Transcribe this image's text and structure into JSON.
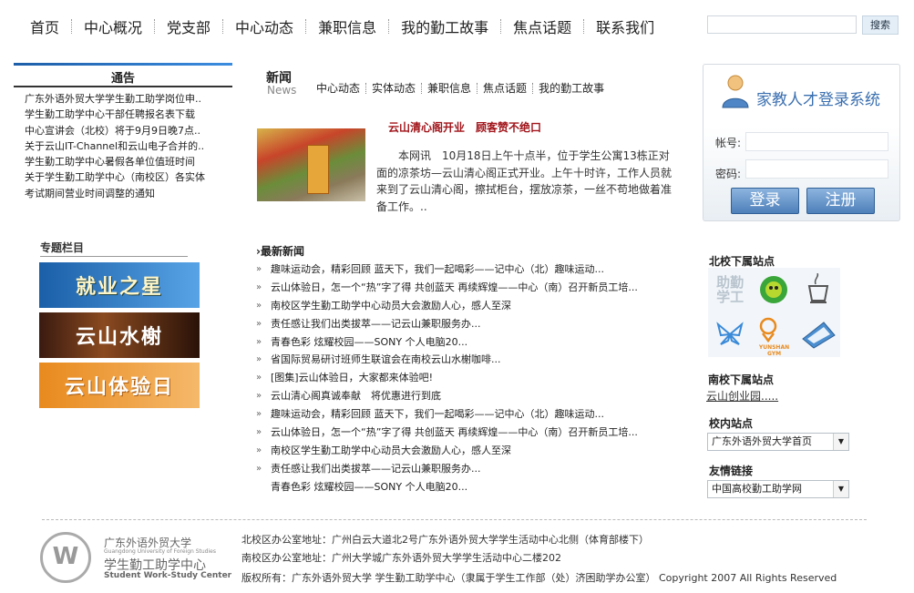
{
  "nav": {
    "items": [
      "首页",
      "中心概况",
      "党支部",
      "中心动态",
      "兼职信息",
      "我的勤工故事",
      "焦点话题",
      "联系我们"
    ]
  },
  "search": {
    "placeholder": "",
    "button": "搜索"
  },
  "notice": {
    "title": "通告",
    "items": [
      "广东外语外贸大学学生勤工助学岗位申..",
      "学生勤工助学中心干部任聘报名表下载",
      "中心宣讲会（北校）将于9月9日晚7点..",
      "关于云山IT-Channel和云山电子合并的..",
      "学生勤工助学中心暑假各单位值班时间",
      "关于学生勤工助学中心（南校区）各实体",
      "考试期间营业时间调整的通知"
    ]
  },
  "topics": {
    "title": "专题栏目",
    "banners": [
      "就业之星",
      "云山水榭",
      "云山体验日"
    ]
  },
  "news": {
    "title": "新闻",
    "subtitle": "News",
    "tabs": [
      "中心动态",
      "实体动态",
      "兼职信息",
      "焦点话题",
      "我的勤工故事"
    ],
    "featured": {
      "title": "云山清心阁开业　顾客赞不绝口",
      "text": "本网讯　10月18日上午十点半，位于学生公寓13栋正对面的凉茶坊—云山清心阁正式开业。上午十时许，工作人员就来到了云山清心阁，擦拭柜台，摆放凉茶，一丝不苟地做着准备工作。.."
    },
    "latest_title": "最新新闻",
    "latest": [
      "趣味运动会，精彩回顾 蓝天下，我们一起喝彩——记中心（北）趣味运动...",
      "云山体验日，怎一个“热”字了得 共创蓝天 再续辉煌——中心（南）召开新员工培...",
      "南校区学生勤工助学中心动员大会激励人心，感人至深",
      "责任感让我们出类拔萃——记云山兼职服务办...",
      "青春色彩 炫耀校园——SONY 个人电脑20...",
      "省国际贸易研讨班师生联谊会在南校云山水榭咖啡...",
      "[图集]云山体验日，大家都来体验吧!",
      "云山清心阁真诚奉献　将优惠进行到底",
      "趣味运动会，精彩回顾 蓝天下，我们一起喝彩——记中心（北）趣味运动...",
      "云山体验日，怎一个“热”字了得 共创蓝天 再续辉煌——中心（南）召开新员工培...",
      "南校区学生勤工助学中心动员大会激励人心，感人至深",
      "责任感让我们出类拔萃——记云山兼职服务办...",
      "青春色彩 炫耀校园——SONY 个人电脑20..."
    ]
  },
  "login": {
    "title": "家教人才登录系统",
    "account_label": "帐号:",
    "password_label": "密码:",
    "login_button": "登录",
    "register_button": "注册"
  },
  "side": {
    "north_title": "北校下属站点",
    "north_logo_text": "助勤学工",
    "north_logo_text_2": "YUNSHAN GYM",
    "south_title": "南校下属站点",
    "south_link": "云山创业园.....",
    "campus_title": "校内站点",
    "campus_select": "广东外语外贸大学首页",
    "friend_title": "友情链接",
    "friend_select": "中国高校勤工助学网"
  },
  "footer": {
    "school": "广东外语外贸大学",
    "school_en": "Guangdong University of Foreign Studies",
    "center": "学生勤工助学中心",
    "center_en": "Student Work-Study Center",
    "line1": "北校区办公室地址：广州白云大道北2号广东外语外贸大学学生活动中心北侧（体育部楼下）",
    "line2": "南校区办公室地址：广州大学城广东外语外贸大学学生活动中心二楼202",
    "line3": "版权所有：广东外语外贸大学 学生勤工助学中心（隶属于学生工作部（处）济困助学办公室） Copyright  2007 All Rights Reserved"
  },
  "colors": {
    "accent": "#3a6fb0",
    "featured_title": "#a0141a",
    "link": "#333333"
  }
}
